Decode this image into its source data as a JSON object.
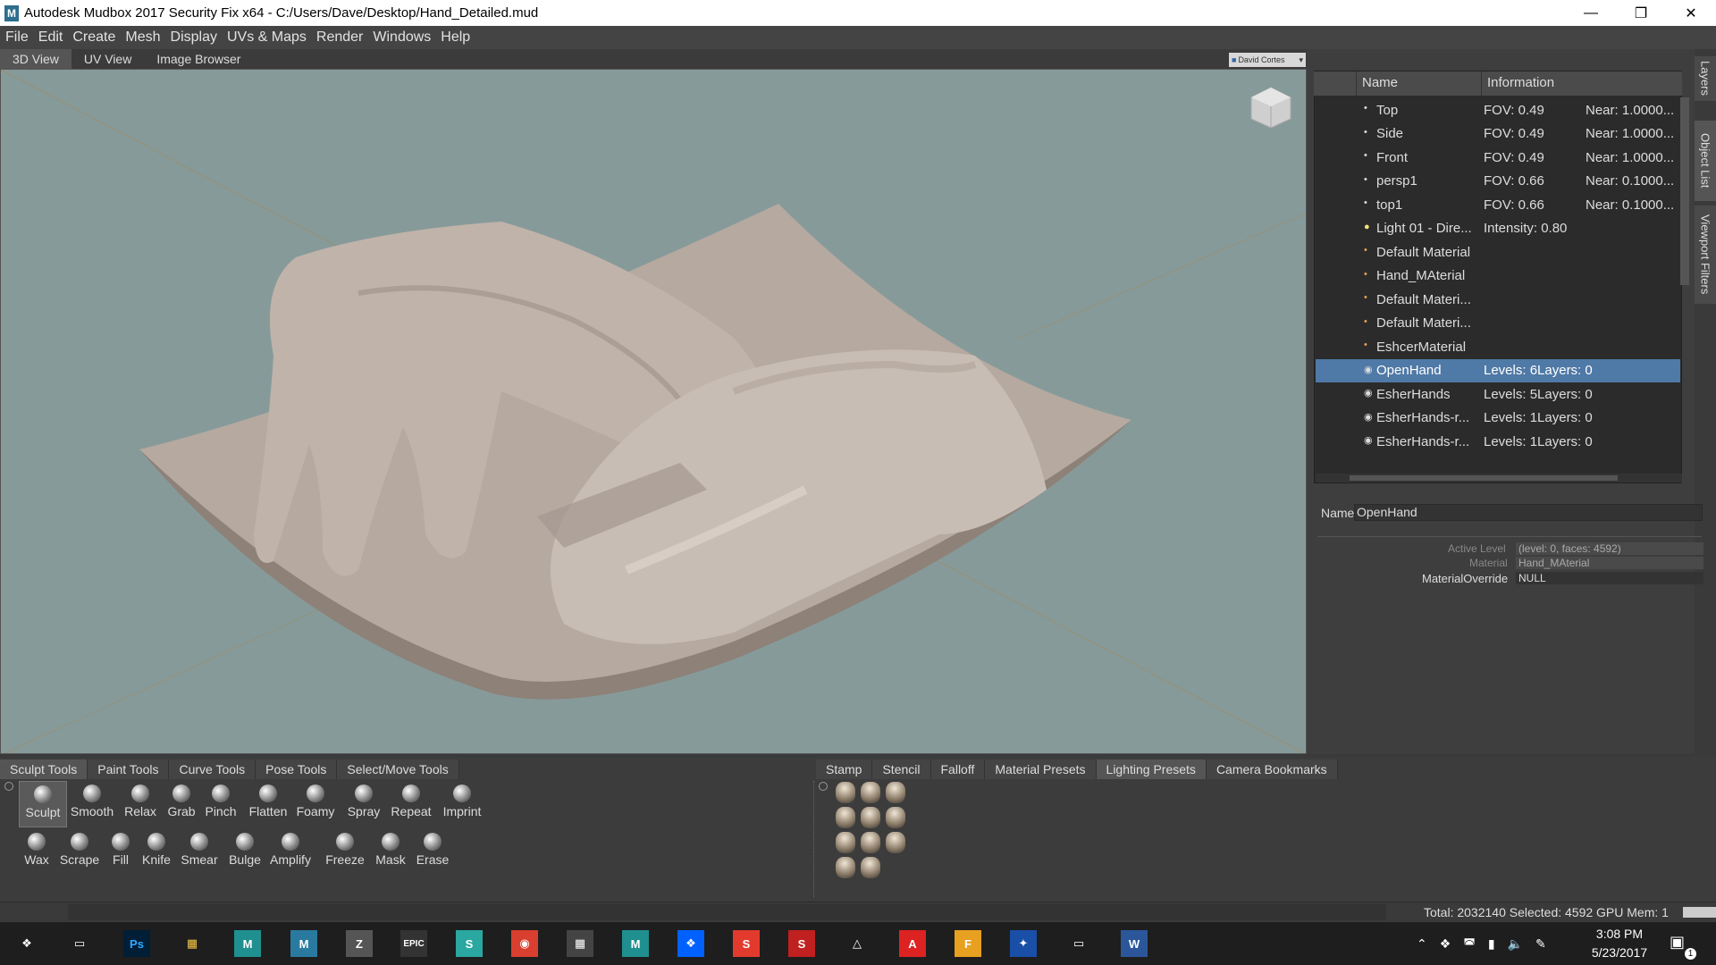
{
  "window": {
    "title": "Autodesk Mudbox 2017 Security Fix x64 - C:/Users/Dave/Desktop/Hand_Detailed.mud",
    "app_icon": "M"
  },
  "menu": [
    "File",
    "Edit",
    "Create",
    "Mesh",
    "Display",
    "UVs & Maps",
    "Render",
    "Windows",
    "Help"
  ],
  "view_tabs": [
    "3D View",
    "UV View",
    "Image Browser"
  ],
  "user": "David Cortes",
  "side_tabs": [
    "Layers",
    "Object List",
    "Viewport Filters"
  ],
  "object_list": {
    "headers": [
      "Name",
      "Information"
    ],
    "rows": [
      {
        "icon": "camera-icon",
        "name": "Top",
        "info": "FOV: 0.49",
        "info2": "Near: 1.0000..."
      },
      {
        "icon": "camera-icon",
        "name": "Side",
        "info": "FOV: 0.49",
        "info2": "Near: 1.0000..."
      },
      {
        "icon": "camera-icon",
        "name": "Front",
        "info": "FOV: 0.49",
        "info2": "Near: 1.0000..."
      },
      {
        "icon": "camera-icon",
        "name": "persp1",
        "info": "FOV: 0.66",
        "info2": "Near: 0.1000..."
      },
      {
        "icon": "camera-icon",
        "name": "top1",
        "info": "FOV: 0.66",
        "info2": "Near: 0.1000..."
      },
      {
        "icon": "light-icon",
        "name": "Light 01 - Dire...",
        "info": "Intensity: 0.80",
        "info2": ""
      },
      {
        "icon": "material-icon",
        "name": "Default Material",
        "info": "",
        "info2": ""
      },
      {
        "icon": "material-icon",
        "name": "Hand_MAterial",
        "info": "",
        "info2": ""
      },
      {
        "icon": "material-icon",
        "name": "Default Materi...",
        "info": "",
        "info2": ""
      },
      {
        "icon": "material-icon",
        "name": "Default Materi...",
        "info": "",
        "info2": ""
      },
      {
        "icon": "material-icon",
        "name": "EshcerMaterial",
        "info": "",
        "info2": ""
      },
      {
        "icon": "mesh-icon",
        "name": "OpenHand",
        "info": "Levels: 6Layers: 0",
        "info2": "",
        "selected": true
      },
      {
        "icon": "mesh-icon",
        "name": "EsherHands",
        "info": "Levels: 5Layers: 0",
        "info2": ""
      },
      {
        "icon": "mesh-icon",
        "name": "EsherHands-r...",
        "info": "Levels: 1Layers: 0",
        "info2": ""
      },
      {
        "icon": "mesh-icon",
        "name": "EsherHands-r...",
        "info": "Levels: 1Layers: 0",
        "info2": ""
      }
    ]
  },
  "properties": {
    "name_label": "Name",
    "name_value": "OpenHand",
    "active_level_label": "Active Level",
    "active_level_value": "(level: 0, faces: 4592)",
    "material_label": "Material",
    "material_value": "Hand_MAterial",
    "override_label": "MaterialOverride",
    "override_value": "NULL"
  },
  "tool_tabs": [
    "Sculpt Tools",
    "Paint Tools",
    "Curve Tools",
    "Pose Tools",
    "Select/Move Tools"
  ],
  "preset_tabs": [
    "Stamp",
    "Stencil",
    "Falloff",
    "Material Presets",
    "Lighting Presets",
    "Camera Bookmarks"
  ],
  "tools_row1": [
    "Sculpt",
    "Smooth",
    "Relax",
    "Grab",
    "Pinch",
    "Flatten",
    "Foamy",
    "Spray",
    "Repeat",
    "Imprint"
  ],
  "tools_row2": [
    "Wax",
    "Scrape",
    "Fill",
    "Knife",
    "Smear",
    "Bulge",
    "Amplify",
    "Freeze",
    "Mask",
    "Erase"
  ],
  "status": "Total: 2032140   Selected: 4592 GPU Mem: 1",
  "clock": {
    "time": "3:08 PM",
    "date": "5/23/2017"
  },
  "notifications": "1",
  "taskbar_icons": [
    "windows-icon",
    "task-view-icon",
    "photoshop-icon",
    "file-explorer-icon",
    "maya-icon",
    "mudbox-icon",
    "zbrush-icon",
    "epic-games-icon",
    "app-s-icon",
    "chrome-icon",
    "calculator-icon",
    "maya-icon-2",
    "dropbox-icon",
    "app-red-icon",
    "substance-icon",
    "unity-icon",
    "acrobat-icon",
    "app-f-icon",
    "app-figure-icon",
    "oculus-icon",
    "word-icon"
  ],
  "taskbar_labels": {
    "photoshop": "Ps",
    "maya": "M",
    "mudbox": "M",
    "epic": "EPIC",
    "word": "W",
    "app_f": "F"
  }
}
